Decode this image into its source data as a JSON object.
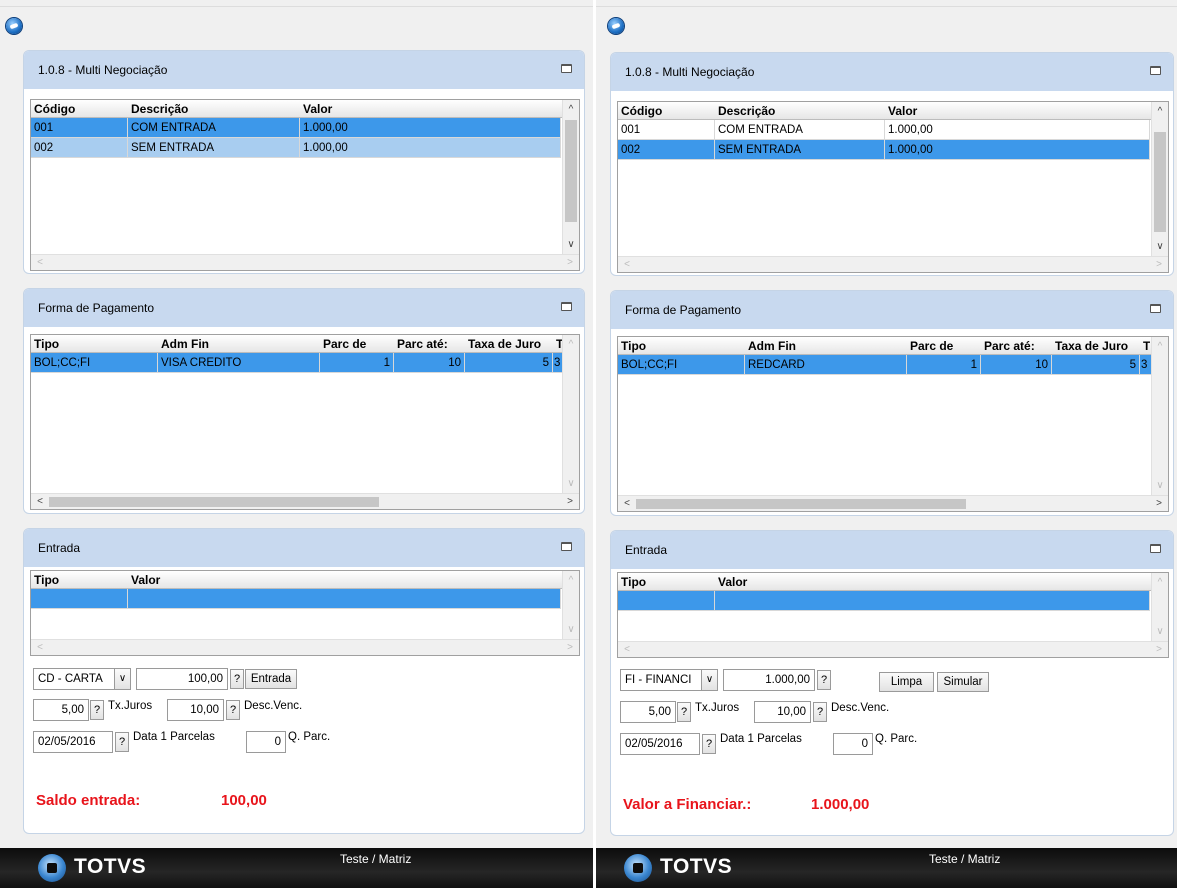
{
  "left": {
    "panel1": {
      "title": "1.0.8 - Multi Negociação",
      "columns": [
        "Código",
        "Descrição",
        "Valor"
      ],
      "rows": [
        [
          "001",
          "COM ENTRADA",
          "1.000,00"
        ],
        [
          "002",
          "SEM ENTRADA",
          "1.000,00"
        ]
      ]
    },
    "panel2": {
      "title": "Forma de Pagamento",
      "columns": [
        "Tipo",
        "Adm Fin",
        "Parc de",
        "Parc até:",
        "Taxa de Juro",
        "T"
      ],
      "rows": [
        [
          "BOL;CC;FI",
          "VISA CREDITO",
          "1",
          "10",
          "5",
          "3"
        ]
      ]
    },
    "panel3": {
      "title": "Entrada",
      "columns": [
        "Tipo",
        "Valor"
      ],
      "dropdown": "CD - CARTA",
      "amount": "100,00",
      "entrada_btn": "Entrada",
      "txjuros_val": "5,00",
      "txjuros_lbl": "Tx.Juros",
      "desc_val": "10,00",
      "desc_lbl": "Desc.Venc.",
      "date_val": "02/05/2016",
      "date_lbl": "Data 1 Parcelas",
      "qparc_val": "0",
      "qparc_lbl": "Q. Parc.",
      "summary_lbl": "Saldo entrada:",
      "summary_val": "100,00"
    },
    "footer": {
      "brand": "TOTVS",
      "text": "Teste / Matriz"
    }
  },
  "right": {
    "panel1": {
      "title": "1.0.8 - Multi Negociação",
      "columns": [
        "Código",
        "Descrição",
        "Valor"
      ],
      "rows": [
        [
          "001",
          "COM ENTRADA",
          "1.000,00"
        ],
        [
          "002",
          "SEM ENTRADA",
          "1.000,00"
        ]
      ]
    },
    "panel2": {
      "title": "Forma de Pagamento",
      "columns": [
        "Tipo",
        "Adm Fin",
        "Parc de",
        "Parc até:",
        "Taxa de Juro",
        "T"
      ],
      "rows": [
        [
          "BOL;CC;FI",
          "REDCARD",
          "1",
          "10",
          "5",
          "3"
        ]
      ]
    },
    "panel3": {
      "title": "Entrada",
      "columns": [
        "Tipo",
        "Valor"
      ],
      "dropdown": "FI - FINANCI",
      "amount": "1.000,00",
      "limpa_btn": "Limpa",
      "simular_btn": "Simular",
      "txjuros_val": "5,00",
      "txjuros_lbl": "Tx.Juros",
      "desc_val": "10,00",
      "desc_lbl": "Desc.Venc.",
      "date_val": "02/05/2016",
      "date_lbl": "Data 1 Parcelas",
      "qparc_val": "0",
      "qparc_lbl": "Q. Parc.",
      "summary_lbl": "Valor a Financiar.:",
      "summary_val": "1.000,00"
    },
    "footer": {
      "brand": "TOTVS",
      "text": "Teste / Matriz"
    }
  },
  "common": {
    "help_symbol": "?",
    "dropdown_arrow": "∨",
    "arrow_up": "^",
    "arrow_down": "∨",
    "arrow_left": "<",
    "arrow_right": ">"
  },
  "colors": {
    "panel_header": "#c8d9ef",
    "selection": "#3d98ea",
    "summary_text": "#e8141b",
    "footer_bg": "#111111"
  }
}
